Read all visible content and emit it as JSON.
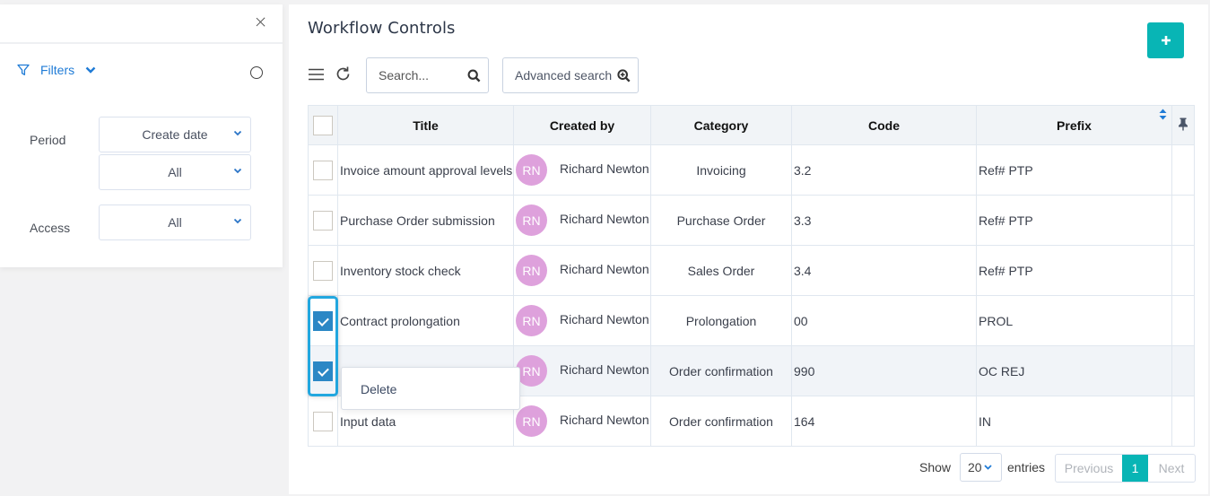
{
  "filter_panel": {
    "close_icon": "close-icon",
    "filters_label": "Filters",
    "period_label": "Period",
    "period_select": "Create date",
    "period_range_select": "All",
    "access_label": "Access",
    "access_select": "All"
  },
  "header": {
    "title": "Workflow Controls",
    "add_button_label": "+"
  },
  "toolbar": {
    "search_placeholder": "Search...",
    "advanced_search_label": "Advanced search"
  },
  "table": {
    "columns": [
      "Title",
      "Created by",
      "Category",
      "Code",
      "Prefix"
    ],
    "rows": [
      {
        "checked": false,
        "title": "Invoice amount approval levels",
        "initials": "RN",
        "created_by": "Richard Newton",
        "category": "Invoicing",
        "code": "3.2",
        "prefix": "Ref# PTP"
      },
      {
        "checked": false,
        "title": "Purchase Order submission",
        "initials": "RN",
        "created_by": "Richard Newton",
        "category": "Purchase Order",
        "code": "3.3",
        "prefix": "Ref# PTP"
      },
      {
        "checked": false,
        "title": "Inventory stock check",
        "initials": "RN",
        "created_by": "Richard Newton",
        "category": "Sales Order",
        "code": "3.4",
        "prefix": "Ref# PTP"
      },
      {
        "checked": true,
        "title": "Contract prolongation",
        "initials": "RN",
        "created_by": "Richard Newton",
        "category": "Prolongation",
        "code": "00",
        "prefix": "PROL"
      },
      {
        "checked": true,
        "title": "",
        "initials": "RN",
        "created_by": "Richard Newton",
        "category": "Order confirmation",
        "code": "990",
        "prefix": "OC REJ"
      },
      {
        "checked": false,
        "title": "Input data",
        "initials": "RN",
        "created_by": "Richard Newton",
        "category": "Order confirmation",
        "code": "164",
        "prefix": "IN"
      }
    ]
  },
  "context_menu": {
    "items": [
      "Delete"
    ]
  },
  "footer": {
    "show_label": "Show",
    "page_size": "20",
    "entries_label": "entries",
    "previous_label": "Previous",
    "current_page": "1",
    "next_label": "Next"
  },
  "colors": {
    "accent": "#08b5b5",
    "link_blue": "#1f7bd6",
    "checkbox_checked": "#2b87c5",
    "avatar": "#dea1dc",
    "selection_outline": "#22a7df"
  }
}
